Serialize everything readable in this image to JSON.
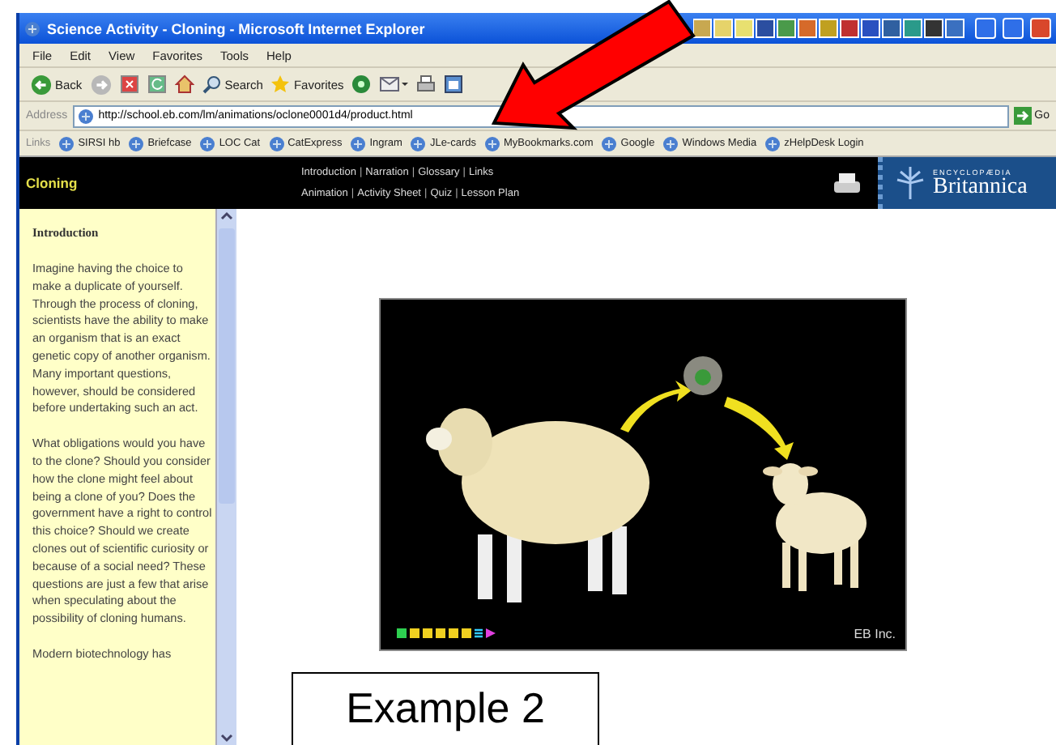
{
  "window": {
    "title": "Science Activity - Cloning - Microsoft Internet Explorer"
  },
  "menu": [
    "File",
    "Edit",
    "View",
    "Favorites",
    "Tools",
    "Help"
  ],
  "toolbar": [
    {
      "kind": "back",
      "label": "Back"
    },
    {
      "kind": "forward"
    },
    {
      "kind": "stop"
    },
    {
      "kind": "refresh"
    },
    {
      "kind": "home"
    },
    {
      "kind": "search",
      "label": "Search"
    },
    {
      "kind": "favorites",
      "label": "Favorites"
    },
    {
      "kind": "media"
    },
    {
      "kind": "mail"
    },
    {
      "kind": "print"
    },
    {
      "kind": "edit"
    }
  ],
  "address": {
    "label": "Address",
    "url": "http://school.eb.com/lm/animations/oclone0001d4/product.html",
    "go": "Go"
  },
  "links": {
    "label": "Links",
    "items": [
      "SIRSI hb",
      "Briefcase",
      "LOC Cat",
      "CatExpress",
      "Ingram",
      "JLe-cards",
      "MyBookmarks.com",
      "Google",
      "Windows Media",
      "zHelpDesk Login"
    ]
  },
  "page": {
    "title": "Cloning",
    "separator": "|",
    "nav_rows": [
      [
        "Introduction",
        "Narration",
        "Glossary",
        "Links"
      ],
      [
        "Animation",
        "Activity Sheet",
        "Quiz",
        "Lesson Plan"
      ]
    ],
    "logo_small": "ENCYCLOPÆDIA",
    "logo_name": "Britannica"
  },
  "sidebar": {
    "heading": "Introduction",
    "paragraphs": [
      "Imagine having the choice to make a duplicate of yourself. Through the process of cloning, scientists have the ability to make an organism that is an exact genetic copy of another organism. Many important questions, however, should be considered before undertaking such an act.",
      "What obligations would you have to the clone? Should you consider how the clone might feel about being a clone of you? Does the government have a right to control this choice? Should we create clones out of scientific curiosity or because of a social need? These questions are just a few that arise when speculating about the possibility of cloning humans.",
      "Modern biotechnology has"
    ]
  },
  "animation": {
    "credit": "EB Inc."
  },
  "annotation": {
    "label": "Example 2"
  }
}
